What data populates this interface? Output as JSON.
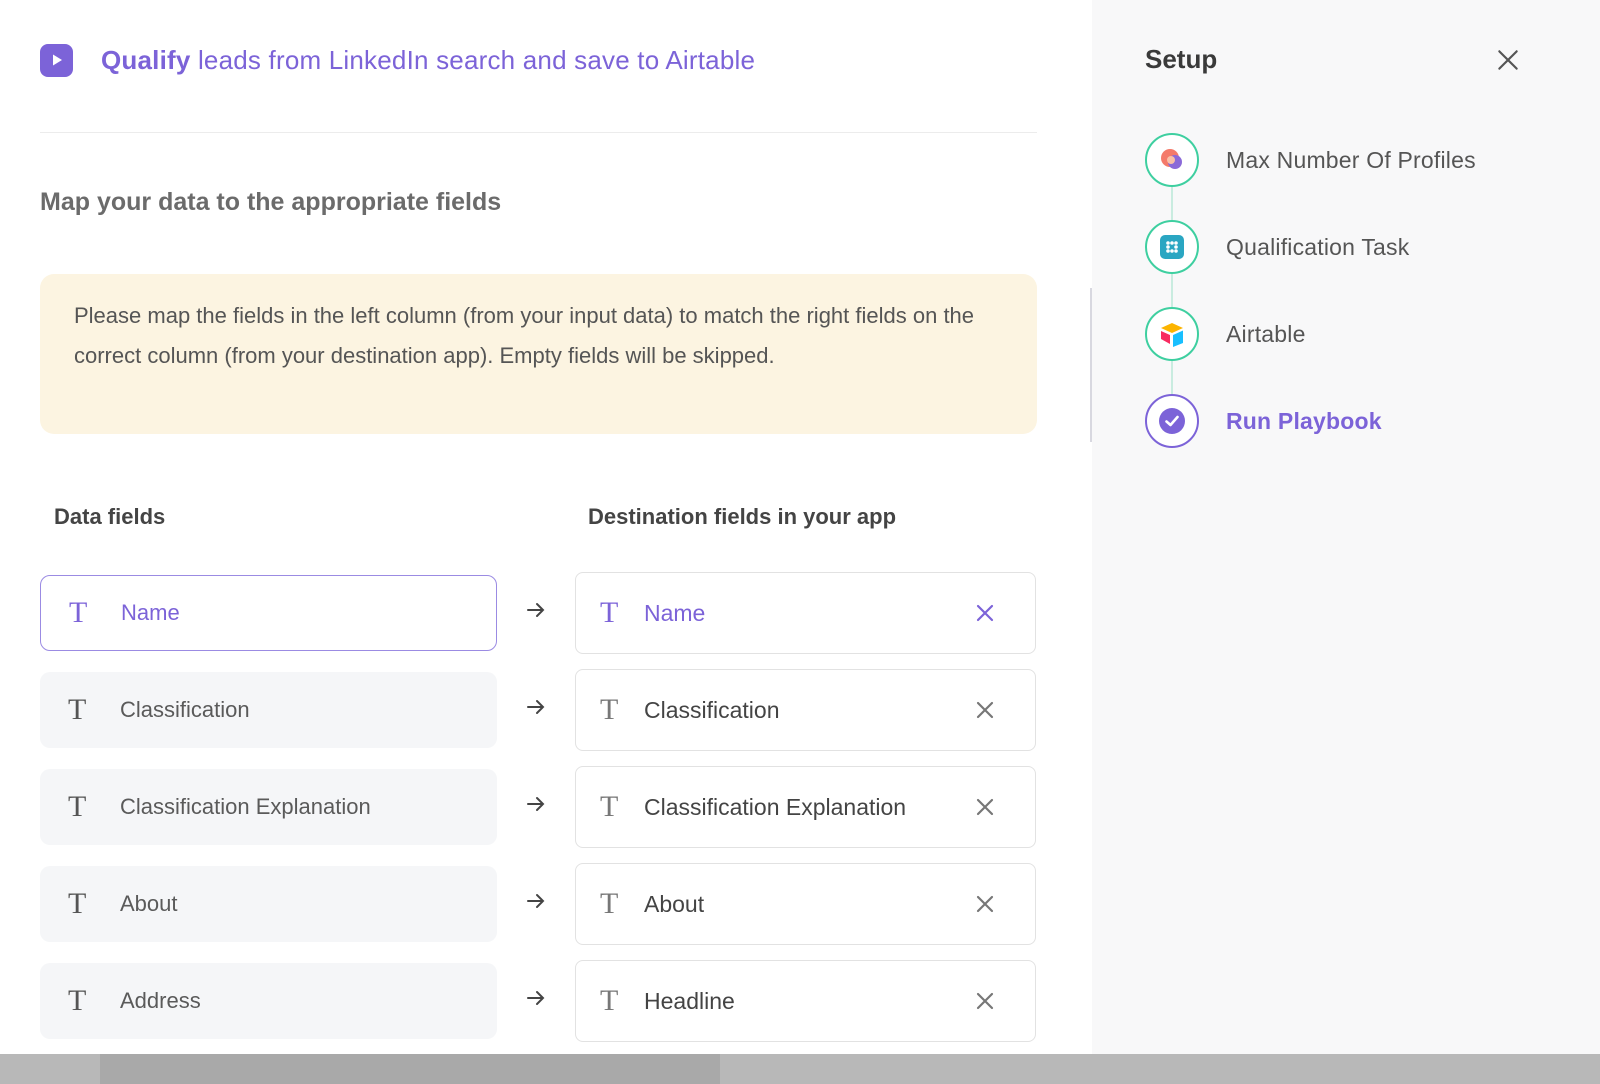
{
  "header": {
    "title_bold": "Qualify",
    "title_rest": " leads from LinkedIn search and save to Airtable"
  },
  "section": {
    "heading": "Map your data to the appropriate fields",
    "notice": "Please map the fields in the left column (from your input data) to match the right fields on the correct column (from your destination app). Empty fields will be skipped."
  },
  "columns": {
    "left": "Data fields",
    "right": "Destination fields in your app"
  },
  "mappings": [
    {
      "source": "Name",
      "destination": "Name",
      "active": true
    },
    {
      "source": "Classification",
      "destination": "Classification",
      "active": false
    },
    {
      "source": "Classification Explanation",
      "destination": "Classification Explanation",
      "active": false
    },
    {
      "source": "About",
      "destination": "About",
      "active": false
    },
    {
      "source": "Address",
      "destination": "Headline",
      "active": false
    }
  ],
  "sidebar": {
    "title": "Setup",
    "steps": [
      {
        "label": "Max Number Of Profiles",
        "icon": "profiles-app-icon",
        "state": "done"
      },
      {
        "label": "Qualification Task",
        "icon": "task-app-icon",
        "state": "done"
      },
      {
        "label": "Airtable",
        "icon": "airtable-icon",
        "state": "done"
      },
      {
        "label": "Run Playbook",
        "icon": "check-circle-icon",
        "state": "current"
      }
    ]
  },
  "colors": {
    "accent": "#7c63d8",
    "step_done": "#3ecfa0",
    "notice_bg": "#fcf4e1"
  }
}
